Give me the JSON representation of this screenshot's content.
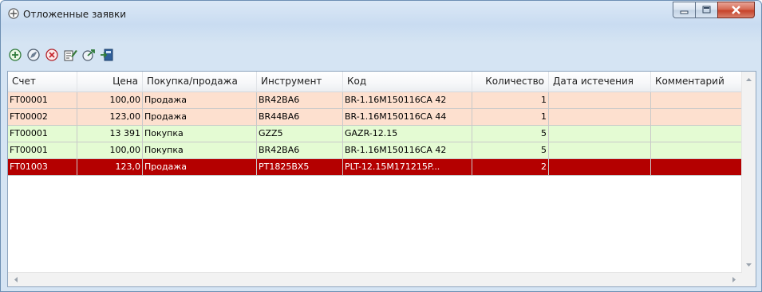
{
  "window": {
    "title": "Отложенные заявки"
  },
  "toolbar": {
    "buttons": [
      {
        "name": "add-order-icon"
      },
      {
        "name": "edit-order-icon"
      },
      {
        "name": "delete-order-icon"
      },
      {
        "name": "edit-list-icon"
      },
      {
        "name": "send-order-icon"
      },
      {
        "name": "export-icon"
      }
    ]
  },
  "table": {
    "columns": [
      "Счет",
      "Цена",
      "Покупка/продажа",
      "Инструмент",
      "Код",
      "Количество",
      "Дата истечения",
      "Комментарий"
    ],
    "rows": [
      {
        "account": "FT00001",
        "price": "100,00",
        "side": "Продажа",
        "instrument": "BR42BA6",
        "code": "BR-1.16M150116CA 42",
        "qty": "1",
        "expiry": "",
        "comment": "",
        "style": "sell"
      },
      {
        "account": "FT00002",
        "price": "123,00",
        "side": "Продажа",
        "instrument": "BR44BA6",
        "code": "BR-1.16M150116CA 44",
        "qty": "1",
        "expiry": "",
        "comment": "",
        "style": "sell"
      },
      {
        "account": "FT00001",
        "price": "13 391",
        "side": "Покупка",
        "instrument": "GZZ5",
        "code": "GAZR-12.15",
        "qty": "5",
        "expiry": "",
        "comment": "",
        "style": "buy"
      },
      {
        "account": "FT00001",
        "price": "100,00",
        "side": "Покупка",
        "instrument": "BR42BA6",
        "code": "BR-1.16M150116CA 42",
        "qty": "5",
        "expiry": "",
        "comment": "",
        "style": "buy"
      },
      {
        "account": "FT01003",
        "price": "123,0",
        "side": "Продажа",
        "instrument": "PT1825BX5",
        "code": "PLT-12.15M171215P...",
        "qty": "2",
        "expiry": "",
        "comment": "",
        "style": "selected"
      }
    ]
  },
  "colors": {
    "sell_row": "#fde0cf",
    "buy_row": "#e4fbd3",
    "selected_row": "#b40000",
    "selected_text": "#ffffff",
    "window_border": "#6d8fb3",
    "close_button": "#c7432a"
  }
}
